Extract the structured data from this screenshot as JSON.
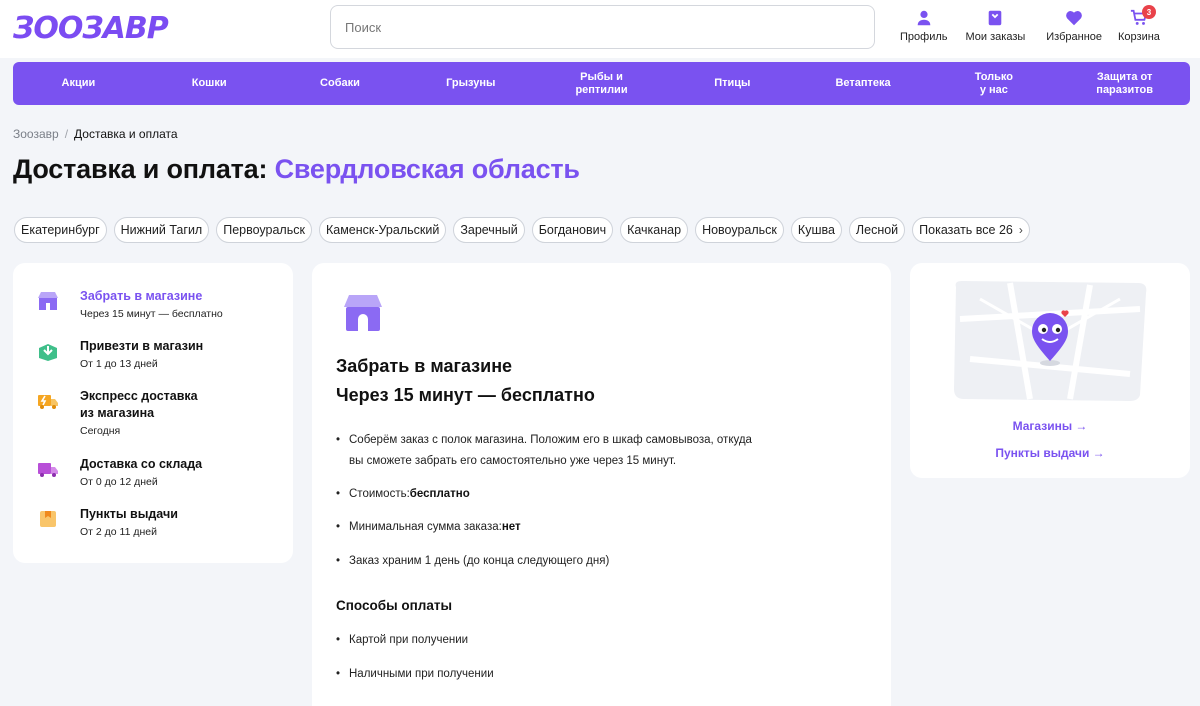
{
  "header": {
    "logo_text": "ЗООЗАВР",
    "search_placeholder": "Поиск",
    "icons": [
      {
        "label": "Профиль",
        "icon": "user-icon"
      },
      {
        "label": "Мои заказы",
        "icon": "orders-icon"
      },
      {
        "label": "Избранное",
        "icon": "heart-icon"
      },
      {
        "label": "Корзина",
        "icon": "cart-icon",
        "badge": "3"
      }
    ]
  },
  "nav": [
    "Акции",
    "Кошки",
    "Собаки",
    "Грызуны",
    "Рыбы и\nрептилии",
    "Птицы",
    "Ветаптека",
    "Только\nу нас",
    "Защита от\nпаразитов"
  ],
  "breadcrumb": {
    "home": "Зоозавр",
    "separator": "/",
    "current": "Доставка и оплата"
  },
  "title": {
    "main": "Доставка и оплата: ",
    "region": "Свердловская область"
  },
  "cities": [
    "Екатеринбург",
    "Нижний Тагил",
    "Первоуральск",
    "Каменск-Уральский",
    "Заречный",
    "Богданович",
    "Качканар",
    "Новоуральск",
    "Кушва",
    "Лесной"
  ],
  "show_all": "Показать все 26",
  "methods": [
    {
      "title": "Забрать в магазине",
      "sub": "Через 15 минут — бесплатно",
      "active": true
    },
    {
      "title": "Привезти в магазин",
      "sub": "От 1 до 13 дней"
    },
    {
      "title": "Экспресс доставка\nиз магазина",
      "sub": "Сегодня"
    },
    {
      "title": "Доставка со склада",
      "sub": "От 0 до 12 дней"
    },
    {
      "title": "Пункты выдачи",
      "sub": "От 2 до 11 дней"
    }
  ],
  "detail": {
    "title1": "Забрать в магазине",
    "title2": "Через 15 минут — бесплатно",
    "bullet1_line1": "Соберём заказ с полок магазина. Положим его в шкаф самовывоза, откуда",
    "bullet1_line2": "вы сможете забрать его самостоятельно уже через 15 минут.",
    "cost_label": "Стоимость: ",
    "cost_value": "бесплатно",
    "min_label": "Минимальная сумма заказа: ",
    "min_value": "нет",
    "storage": "Заказ храним 1 день (до конца следующего дня)",
    "payment_title": "Способы оплаты",
    "payment": [
      "Картой при получении",
      "Наличными при получении"
    ]
  },
  "map_links": {
    "stores": "Магазины →",
    "pickup": "Пункты выдачи →"
  },
  "colors": {
    "accent": "#7a52f0",
    "badge": "#e9424a"
  }
}
